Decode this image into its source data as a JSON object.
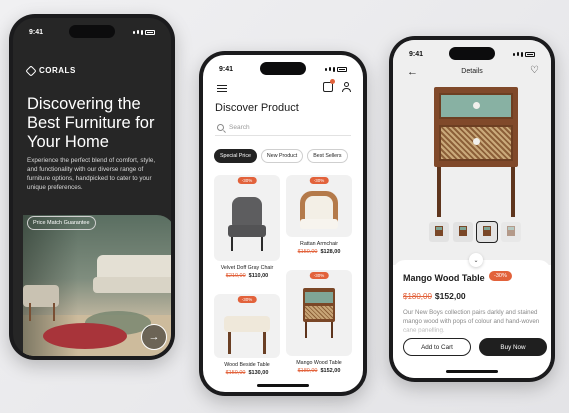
{
  "colors": {
    "accent": "#e2623b",
    "dark": "#262626",
    "teal": "#88b1a3",
    "wood": "#80492a"
  },
  "status_time": "9:41",
  "onboarding": {
    "brand": "CORALS",
    "title": "Discovering the Best Furniture for Your Home",
    "description": "Experience the perfect blend of comfort, style, and functionality with our diverse range of furniture options, handpicked to cater to your unique preferences.",
    "pill": "Price Match Guarantee",
    "next_icon": "arrow-right-icon",
    "next_glyph": "→"
  },
  "catalog": {
    "title": "Discover Product",
    "search_placeholder": "Search",
    "chips": [
      "Special Price",
      "New Product",
      "Best Sellers"
    ],
    "products": [
      {
        "name": "Velvet Doff Gray Chair",
        "old_price": "$210,00",
        "price": "$110,00",
        "badge": "-30%"
      },
      {
        "name": "Rattan Armchair",
        "old_price": "$150,00",
        "price": "$128,00",
        "badge": "-30%"
      },
      {
        "name": "Wood Beside Table",
        "old_price": "$150,00",
        "price": "$130,00",
        "badge": "-30%"
      },
      {
        "name": "Mango Wood Table",
        "old_price": "$180,00",
        "price": "$152,00",
        "badge": "-30%"
      }
    ]
  },
  "detail": {
    "header": "Details",
    "back_glyph": "←",
    "heart_glyph": "♡",
    "collapse_glyph": "⌄",
    "name": "Mango Wood Table",
    "discount": "-30%",
    "old_price": "$180,00",
    "price": "$152,00",
    "description": "Our New Boys collection pairs darkly and stained mango wood with pops of colour and hand-woven cane panelling.",
    "add_to_cart": "Add to Cart",
    "buy_now": "Buy Now"
  }
}
